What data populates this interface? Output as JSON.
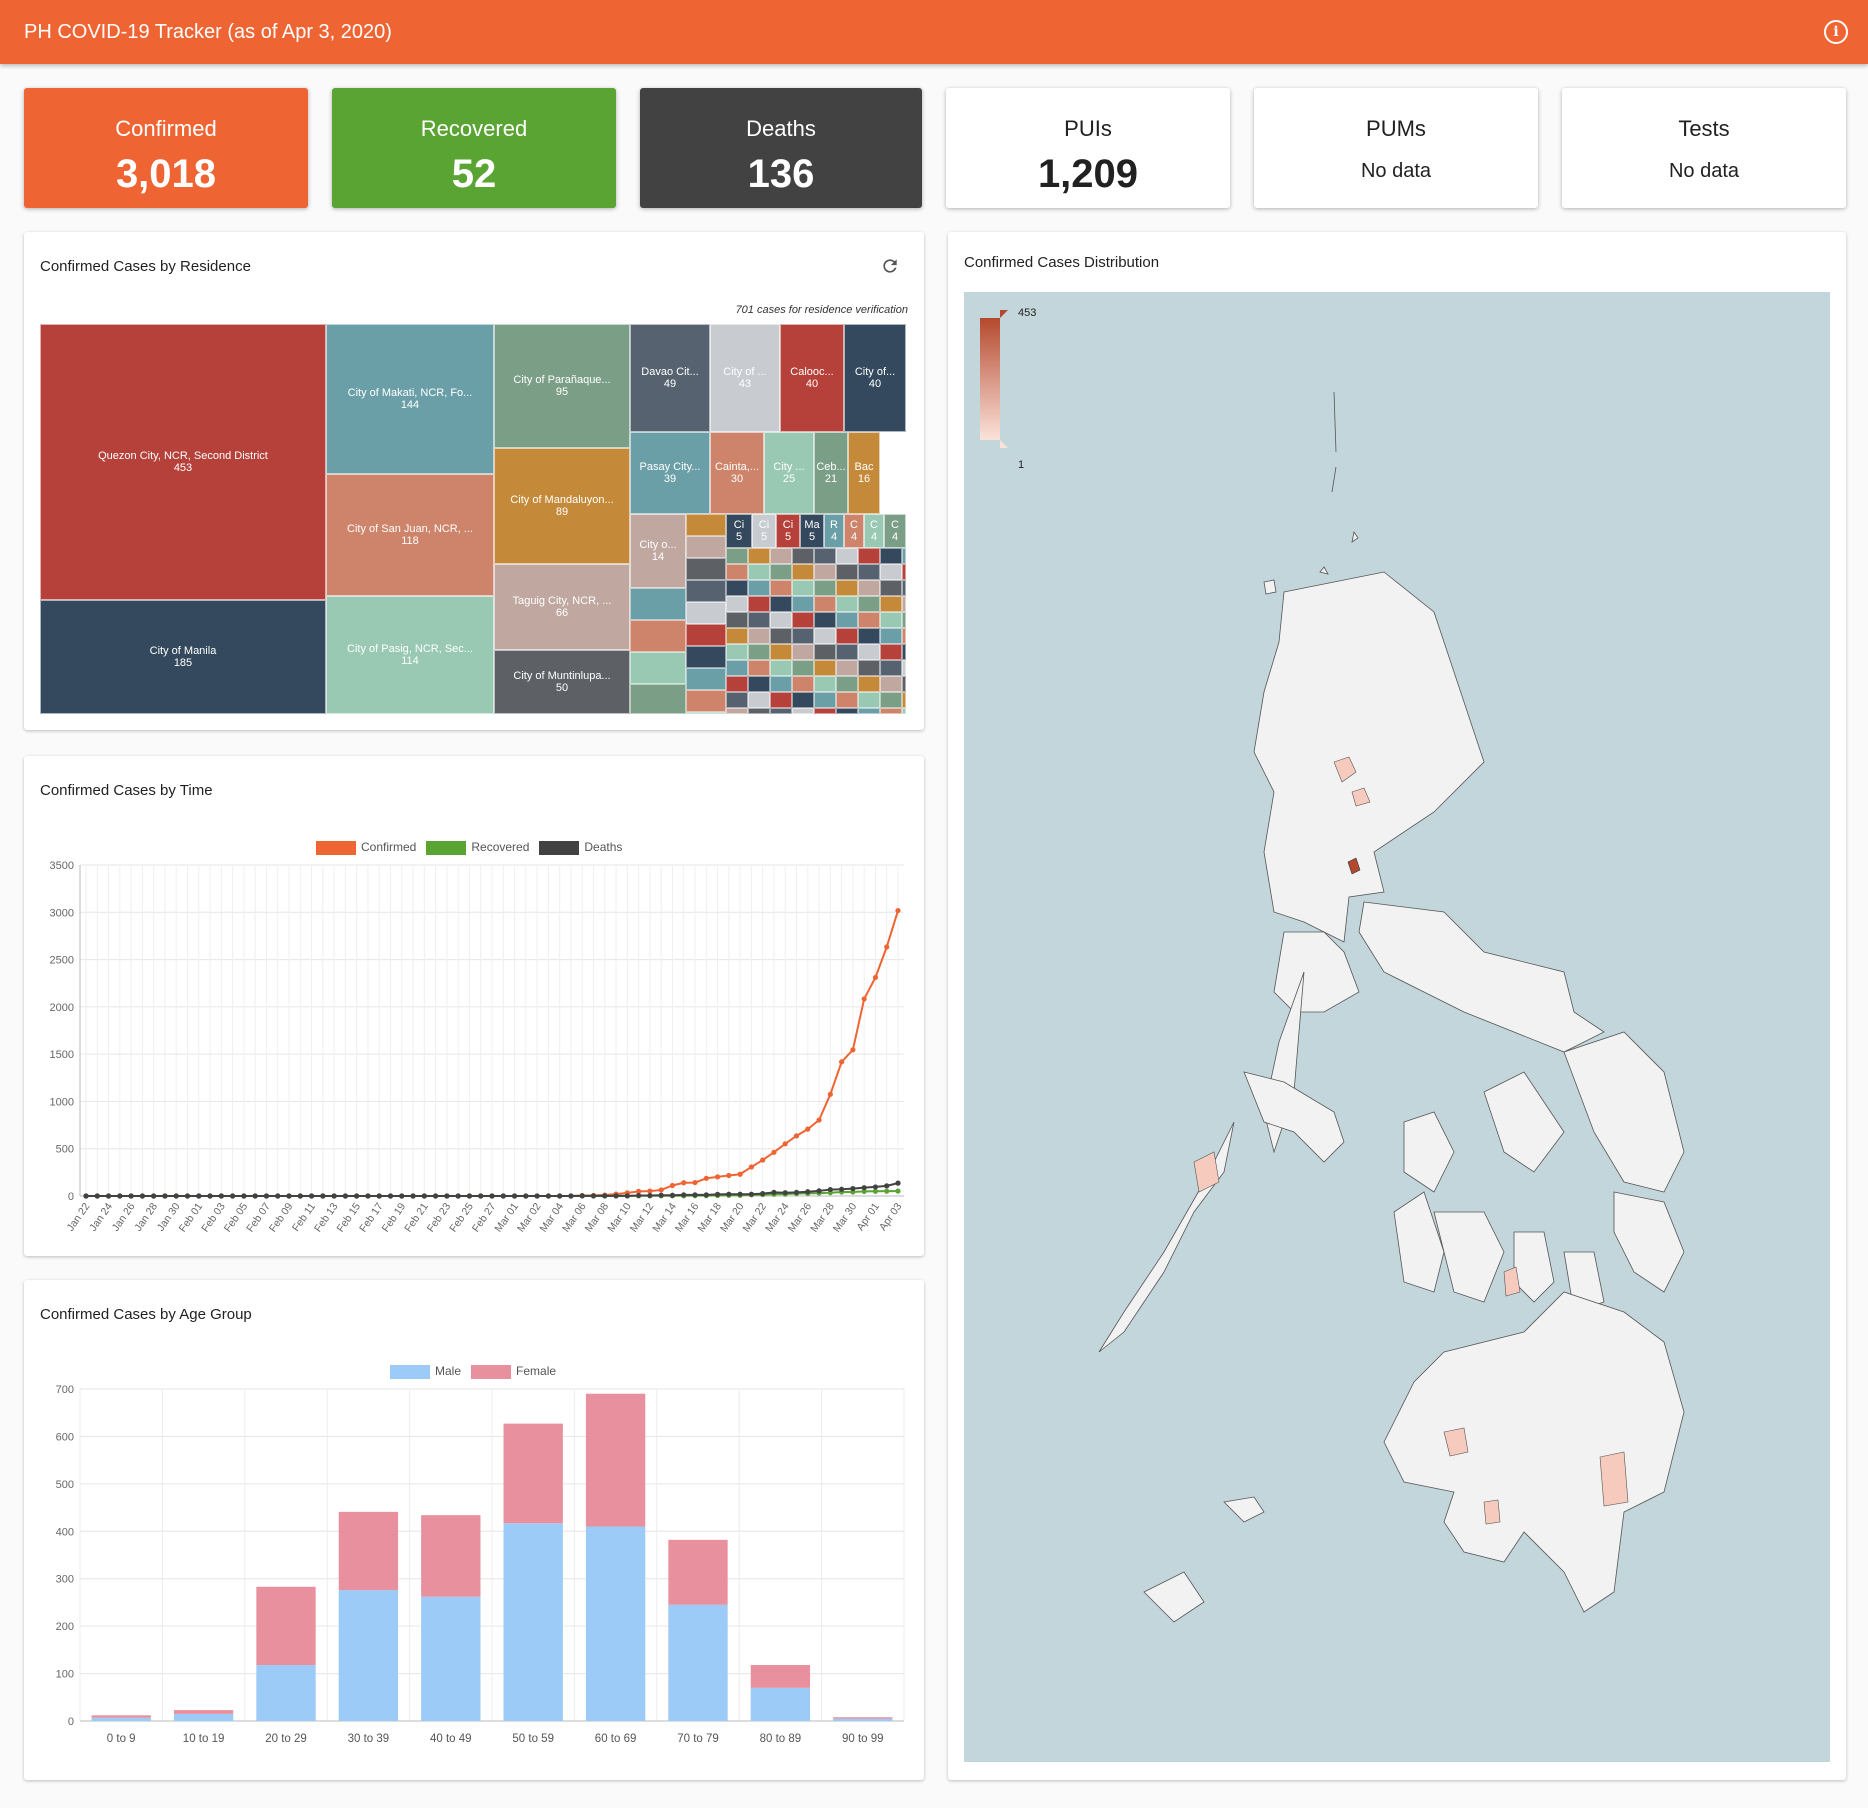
{
  "header": {
    "title": "PH COVID-19 Tracker (as of Apr 3, 2020)",
    "info_icon": "info-icon"
  },
  "stats": [
    {
      "label": "Confirmed",
      "value": "3,018",
      "color": "#ef6433"
    },
    {
      "label": "Recovered",
      "value": "52",
      "color": "#5aa433"
    },
    {
      "label": "Deaths",
      "value": "136",
      "color": "#424242"
    },
    {
      "label": "PUIs",
      "value": "1,209"
    },
    {
      "label": "PUMs",
      "value": "No data"
    },
    {
      "label": "Tests",
      "value": "No data"
    }
  ],
  "residence": {
    "title": "Confirmed Cases by Residence",
    "note": "701 cases for residence verification",
    "cells": [
      {
        "name": "Quezon City, NCR, Second District",
        "value": "453"
      },
      {
        "name": "City of Manila",
        "value": "185"
      },
      {
        "name": "City of Makati, NCR, Fo...",
        "value": "144"
      },
      {
        "name": "City of San Juan, NCR, ...",
        "value": "118"
      },
      {
        "name": "City of Pasig, NCR, Sec...",
        "value": "114"
      },
      {
        "name": "City of Parañaque...",
        "value": "95"
      },
      {
        "name": "City of Mandaluyon...",
        "value": "89"
      },
      {
        "name": "Taguig City, NCR, ...",
        "value": "66"
      },
      {
        "name": "City of Muntinlupa...",
        "value": "50"
      },
      {
        "name": "Davao Cit...",
        "value": "49"
      },
      {
        "name": "City of ...",
        "value": "43"
      },
      {
        "name": "Calooc...",
        "value": "40"
      },
      {
        "name": "City of...",
        "value": "40"
      },
      {
        "name": "Pasay City...",
        "value": "39"
      },
      {
        "name": "Cainta,...",
        "value": "30"
      },
      {
        "name": "City ...",
        "value": "25"
      },
      {
        "name": "Ceb...",
        "value": "21"
      },
      {
        "name": "Bac",
        "value": "16"
      },
      {
        "name": "City o...",
        "value": "14"
      },
      {
        "name": "Ci",
        "value": "5"
      },
      {
        "name": "Ci",
        "value": "5"
      },
      {
        "name": "Ci",
        "value": "5"
      },
      {
        "name": "Ma",
        "value": "5"
      },
      {
        "name": "R",
        "value": "4"
      },
      {
        "name": "C",
        "value": "4"
      },
      {
        "name": "C",
        "value": "4"
      },
      {
        "name": "C",
        "value": "4"
      }
    ]
  },
  "time_card": {
    "title": "Confirmed Cases by Time"
  },
  "age_card": {
    "title": "Confirmed Cases by Age Group"
  },
  "map_card": {
    "title": "Confirmed Cases Distribution",
    "legend_max": "453",
    "legend_min": "1"
  },
  "chart_data": [
    {
      "type": "line",
      "legend": [
        "Confirmed",
        "Recovered",
        "Deaths"
      ],
      "colors": {
        "Confirmed": "#ef6433",
        "Recovered": "#5aa433",
        "Deaths": "#424242"
      },
      "ylim": [
        0,
        3500
      ],
      "yticks": [
        0,
        500,
        1000,
        1500,
        2000,
        2500,
        3000,
        3500
      ],
      "xtick_labels": [
        "Jan 22",
        "Jan 24",
        "Jan 26",
        "Jan 28",
        "Jan 30",
        "Feb 01",
        "Feb 03",
        "Feb 05",
        "Feb 07",
        "Feb 09",
        "Feb 11",
        "Feb 13",
        "Feb 15",
        "Feb 17",
        "Feb 19",
        "Feb 21",
        "Feb 23",
        "Feb 25",
        "Feb 27",
        "Mar 01",
        "Mar 02",
        "Mar 04",
        "Mar 06",
        "Mar 08",
        "Mar 10",
        "Mar 12",
        "Mar 14",
        "Mar 16",
        "Mar 18",
        "Mar 20",
        "Mar 22",
        "Mar 24",
        "Mar 26",
        "Mar 28",
        "Mar 30",
        "Apr 01",
        "Apr 03"
      ],
      "late_dates": [
        "Mar 06",
        "Mar 07",
        "Mar 08",
        "Mar 09",
        "Mar 10",
        "Mar 11",
        "Mar 12",
        "Mar 13",
        "Mar 14",
        "Mar 15",
        "Mar 16",
        "Mar 17",
        "Mar 18",
        "Mar 19",
        "Mar 20",
        "Mar 21",
        "Mar 22",
        "Mar 23",
        "Mar 24",
        "Mar 25",
        "Mar 26",
        "Mar 27",
        "Mar 28",
        "Mar 29",
        "Mar 30",
        "Mar 31",
        "Apr 01",
        "Apr 02",
        "Apr 03"
      ],
      "series": [
        {
          "name": "Confirmed",
          "late_values": [
            5,
            6,
            10,
            20,
            33,
            49,
            52,
            64,
            111,
            140,
            142,
            187,
            202,
            217,
            230,
            307,
            380,
            462,
            552,
            636,
            707,
            803,
            1075,
            1418,
            1546,
            2084,
            2311,
            2633,
            3018
          ]
        },
        {
          "name": "Recovered",
          "late_values": [
            1,
            1,
            1,
            1,
            1,
            2,
            2,
            2,
            2,
            2,
            4,
            4,
            5,
            8,
            8,
            13,
            15,
            18,
            20,
            26,
            28,
            31,
            35,
            42,
            42,
            49,
            50,
            51,
            52
          ]
        },
        {
          "name": "Deaths",
          "late_values": [
            1,
            1,
            1,
            1,
            1,
            5,
            5,
            8,
            8,
            12,
            12,
            12,
            17,
            19,
            19,
            19,
            25,
            38,
            35,
            38,
            45,
            54,
            68,
            71,
            78,
            88,
            96,
            107,
            136
          ]
        }
      ]
    },
    {
      "type": "bar",
      "stacked": true,
      "categories": [
        "0 to 9",
        "10 to 19",
        "20 to 29",
        "30 to 39",
        "40 to 49",
        "50 to 59",
        "60 to 69",
        "70 to 79",
        "80 to 89",
        "90 to 99"
      ],
      "ylim": [
        0,
        700
      ],
      "yticks": [
        0,
        100,
        200,
        300,
        400,
        500,
        600,
        700
      ],
      "series": [
        {
          "name": "Male",
          "color": "#9ccbf7",
          "values": [
            7,
            15,
            118,
            276,
            262,
            417,
            410,
            245,
            70,
            5
          ]
        },
        {
          "name": "Female",
          "color": "#e8909d",
          "values": [
            5,
            8,
            165,
            165,
            172,
            210,
            280,
            137,
            48,
            3
          ]
        }
      ]
    }
  ]
}
